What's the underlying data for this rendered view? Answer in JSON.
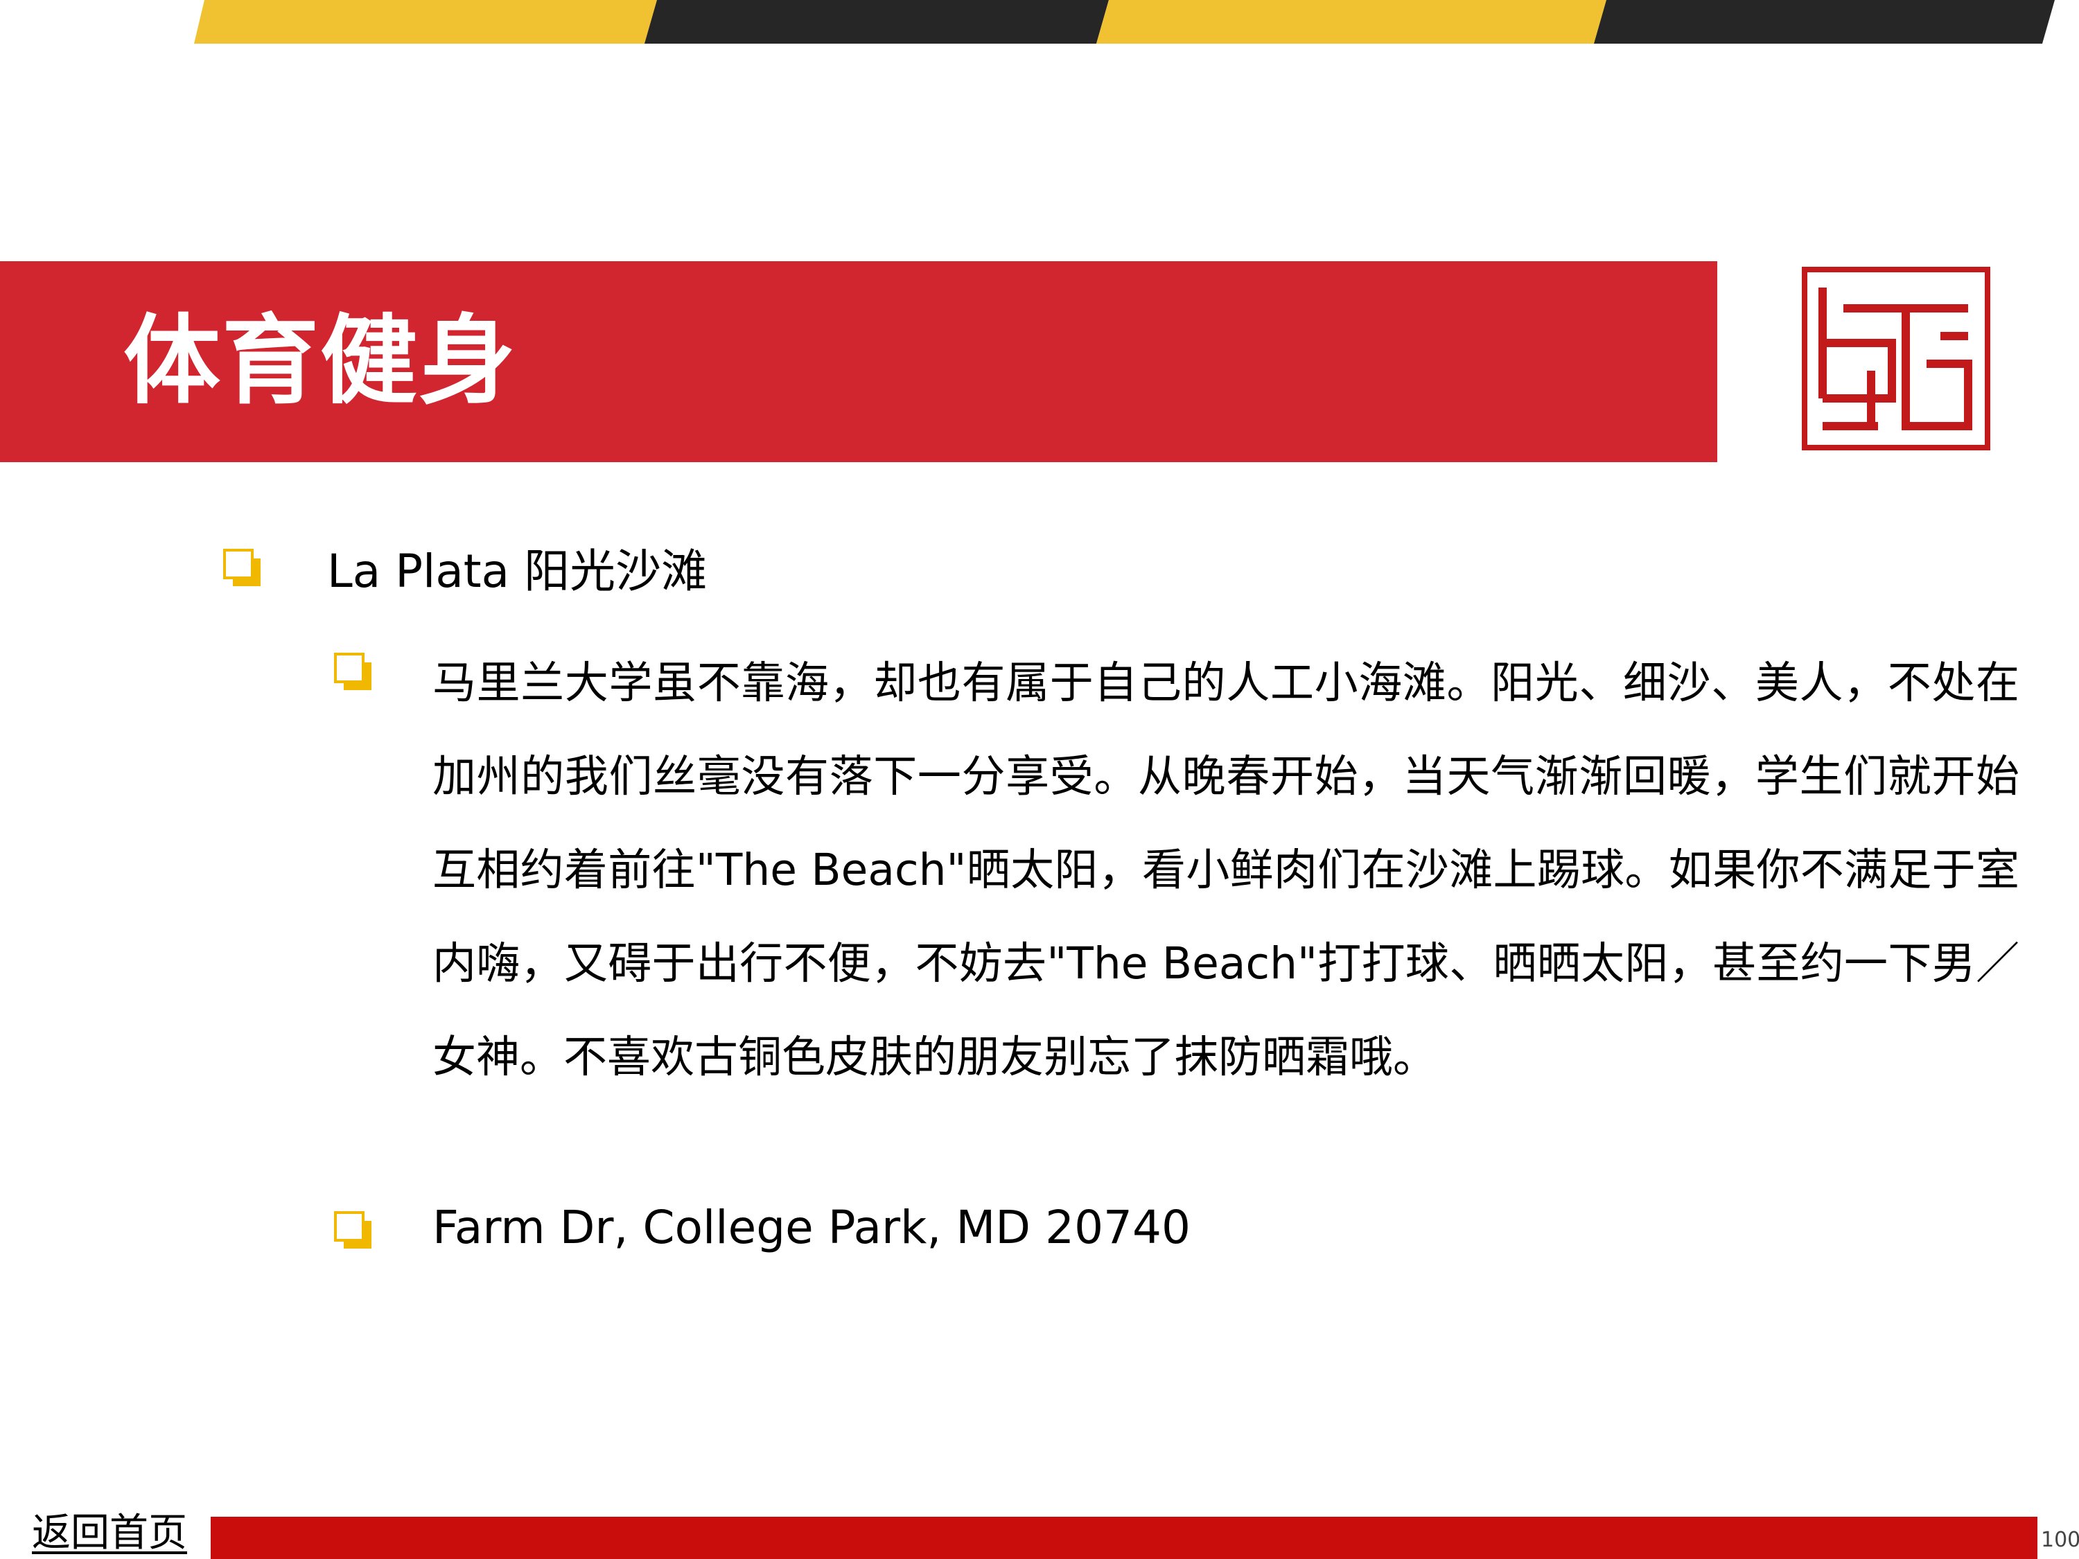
{
  "colors": {
    "accent_yellow": "#F0C231",
    "stripe_dark": "#262626",
    "title_red": "#D1252F",
    "bottom_red": "#C90C0C",
    "seal_red": "#C21A1A",
    "bullet_yellow": "#F0B800"
  },
  "header": {
    "title": "体育健身"
  },
  "logo": {
    "icon": "red-seal-icon"
  },
  "content": {
    "items": [
      {
        "bullet_icon": "square-bullet-icon",
        "text": "La Plata 阳光沙滩",
        "children": [
          {
            "bullet_icon": "square-bullet-icon",
            "text": "马里兰大学虽不靠海，却也有属于自己的人工小海滩。阳光、细沙、美人，不处在加州的我们丝毫没有落下一分享受。从晚春开始，当天气渐渐回暖，学生们就开始互相约着前往\"The Beach\"晒太阳，看小鲜肉们在沙滩上踢球。如果你不满足于室内嗨，又碍于出行不便，不妨去\"The Beach\"打打球、晒晒太阳，甚至约一下男／女神。不喜欢古铜色皮肤的朋友别忘了抹防晒霜哦。"
          },
          {
            "bullet_icon": "square-bullet-icon",
            "text": "Farm Dr, College Park, MD 20740"
          }
        ]
      }
    ]
  },
  "footer": {
    "home_link": "返回首页",
    "page_number": "100"
  }
}
